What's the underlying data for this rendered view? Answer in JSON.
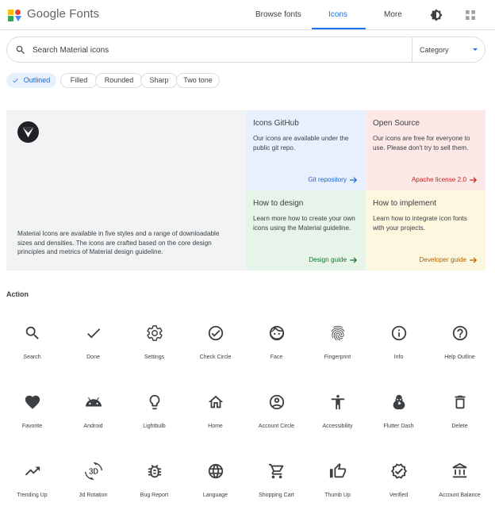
{
  "header": {
    "brand": "Google Fonts",
    "nav": {
      "browse": "Browse fonts",
      "icons": "Icons",
      "more": "More"
    }
  },
  "search": {
    "placeholder": "Search Material icons",
    "category": "Category"
  },
  "chips": [
    {
      "label": "Outlined",
      "active": true
    },
    {
      "label": "Filled",
      "active": false
    },
    {
      "label": "Rounded",
      "active": false
    },
    {
      "label": "Sharp",
      "active": false
    },
    {
      "label": "Two tone",
      "active": false
    }
  ],
  "intro": {
    "text": "Material Icons are available in five styles and a range of downloadable sizes and densities. The icons are crafted based on the core design principles and metrics of Material design guideline."
  },
  "cards": {
    "github": {
      "title": "Icons GitHub",
      "desc": "Our icons are available under the public git repo.",
      "link": "Git repository"
    },
    "source": {
      "title": "Open Source",
      "desc": "Our icons are free for everyone to use. Please don't try to sell them.",
      "link": "Apache license 2.0"
    },
    "design": {
      "title": "How to design",
      "desc": "Learn more how to create your own icons using the Material guideline.",
      "link": "Design guide"
    },
    "impl": {
      "title": "How to implement",
      "desc": "Learn how to integrate icon fonts with your projects.",
      "link": "Developer guide"
    }
  },
  "section": {
    "title": "Action"
  },
  "icons": [
    {
      "name": "search-icon",
      "label": "Search"
    },
    {
      "name": "done-icon",
      "label": "Done"
    },
    {
      "name": "settings-icon",
      "label": "Settings"
    },
    {
      "name": "check-circle-icon",
      "label": "Check Circle"
    },
    {
      "name": "face-icon",
      "label": "Face"
    },
    {
      "name": "fingerprint-icon",
      "label": "Fingerprint"
    },
    {
      "name": "info-icon",
      "label": "Info"
    },
    {
      "name": "help-outline-icon",
      "label": "Help Outline"
    },
    {
      "name": "favorite-icon",
      "label": "Favorite"
    },
    {
      "name": "android-icon",
      "label": "Android"
    },
    {
      "name": "lightbulb-icon",
      "label": "Lightbulb"
    },
    {
      "name": "home-icon",
      "label": "Home"
    },
    {
      "name": "account-circle-icon",
      "label": "Account Circle"
    },
    {
      "name": "accessibility-icon",
      "label": "Accessibility"
    },
    {
      "name": "flutter-dash-icon",
      "label": "Flutter Dash"
    },
    {
      "name": "delete-icon",
      "label": "Delete"
    },
    {
      "name": "trending-up-icon",
      "label": "Trending Up"
    },
    {
      "name": "3d-rotation-icon",
      "label": "3d Rotation"
    },
    {
      "name": "bug-report-icon",
      "label": "Bug Report"
    },
    {
      "name": "language-icon",
      "label": "Language"
    },
    {
      "name": "shopping-cart-icon",
      "label": "Shopping Cart"
    },
    {
      "name": "thumb-up-icon",
      "label": "Thumb Up"
    },
    {
      "name": "verified-icon",
      "label": "Verified"
    },
    {
      "name": "account-balance-icon",
      "label": "Account Balance"
    }
  ]
}
